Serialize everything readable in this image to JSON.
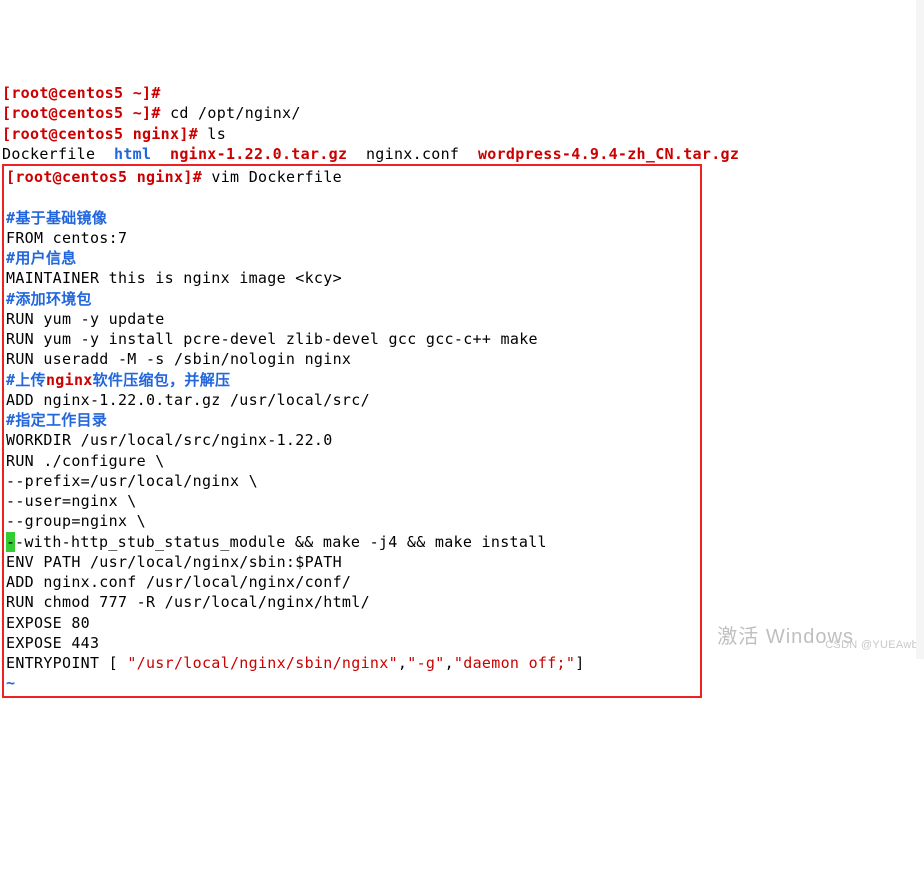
{
  "prompt": {
    "user": "root",
    "host": "centos5",
    "path_home": "~",
    "path_nginx": "nginx",
    "bracket_open": "[",
    "bracket_close": "]",
    "at": "@",
    "hash": "#"
  },
  "cmds": {
    "cd": "cd /opt/nginx/",
    "ls": "ls",
    "vim": "vim Dockerfile"
  },
  "ls_output": {
    "dockerfile": "Dockerfile",
    "html": "html",
    "nginx_tgz": "nginx-1.22.0.tar.gz",
    "nginx_conf": "nginx.conf",
    "wordpress_tgz": "wordpress-4.9.4-zh_CN.tar.gz"
  },
  "dockerfile": {
    "c1a": "#",
    "c1b": "基于基础镜像",
    "l1": "FROM centos:7",
    "c2a": "#",
    "c2b": "用户信息",
    "l2": "MAINTAINER this is nginx image <kcy>",
    "c3a": "#",
    "c3b": "添加环境包",
    "l3": "RUN yum -y update",
    "l4": "RUN yum -y install pcre-devel zlib-devel gcc gcc-c++ make",
    "l5": "RUN useradd -M -s /sbin/nologin nginx",
    "c4a": "#",
    "c4b": "上传",
    "c4nginx": "nginx",
    "c4c": "软件压缩包，并解压",
    "l6": "ADD nginx-1.22.0.tar.gz /usr/local/src/",
    "c5a": "#",
    "c5b": "指定工作目录",
    "l7": "WORKDIR /usr/local/src/nginx-1.22.0",
    "l8": "RUN ./configure \\",
    "l9": "--prefix=/usr/local/nginx \\",
    "l10": "--user=nginx \\",
    "l11": "--group=nginx \\",
    "l12a": "-",
    "l12b": "-with-http_stub_status_module && make -j4 && make install",
    "l13": "ENV PATH /usr/local/nginx/sbin:$PATH",
    "l14": "ADD nginx.conf /usr/local/nginx/conf/",
    "l15": "RUN chmod 777 -R /usr/local/nginx/html/",
    "l16": "EXPOSE 80",
    "l17": "EXPOSE 443",
    "l18a": "ENTRYPOINT [ ",
    "l18b": "\"/usr/local/nginx/sbin/nginx\"",
    "l18c": ",",
    "l18d": "\"-g\"",
    "l18e": ",",
    "l18f": "\"daemon off;\"",
    "l18g": "]",
    "tilde": "~"
  },
  "watermark1": "激活 Windows",
  "watermark2": "CSDN @YUEAwb"
}
